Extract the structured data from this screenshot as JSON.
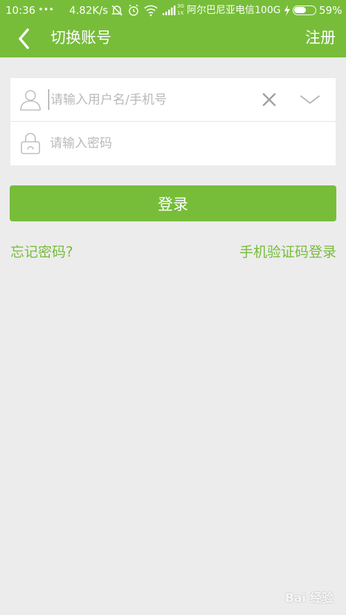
{
  "status_bar": {
    "time": "10:36",
    "more": "•••",
    "speed": "4.82K/s",
    "net_types": [
      "3G",
      "1X"
    ],
    "carrier": "阿尔巴尼亚电信100G",
    "battery": "59%",
    "battery_level": 0.59
  },
  "app_bar": {
    "title": "切换账号",
    "register": "注册"
  },
  "form": {
    "username_placeholder": "请输入用户名/手机号",
    "password_placeholder": "请输入密码"
  },
  "login_button": "登录",
  "links": {
    "forgot": "忘记密码?",
    "sms_login": "手机验证码登录"
  },
  "watermark": "Bai 经验",
  "colors": {
    "accent": "#77bd3a",
    "background": "#ececec"
  }
}
